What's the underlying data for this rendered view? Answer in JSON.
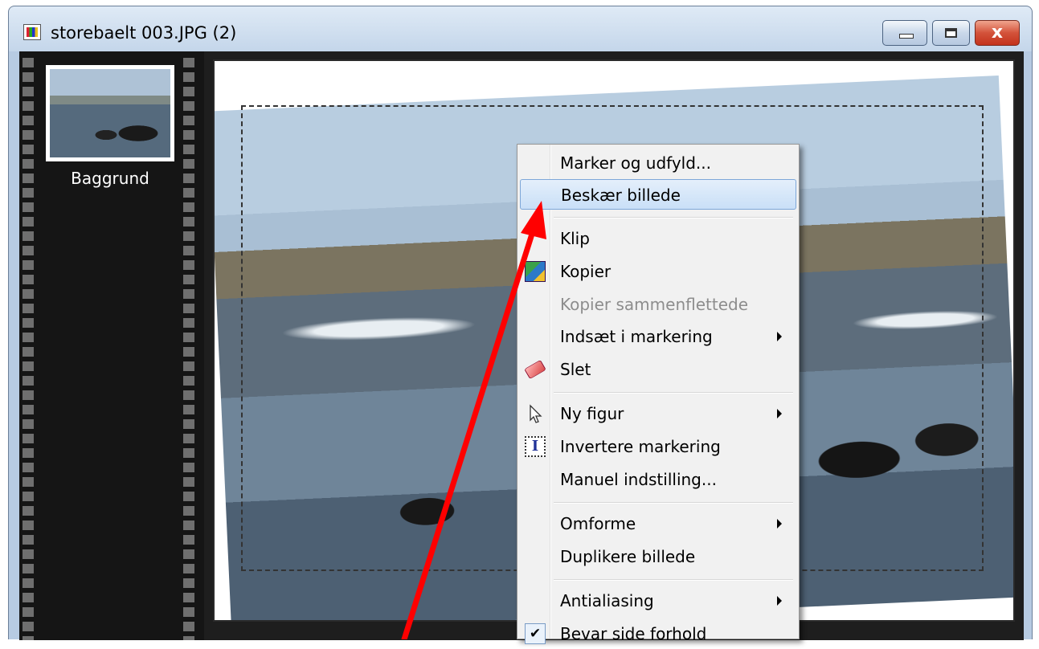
{
  "window": {
    "title": "storebaelt 003.JPG (2)",
    "close_glyph": "x",
    "icons": {
      "app": "image-document-icon",
      "minimize": "minimize-icon",
      "maximize": "maximize-icon",
      "close": "close-icon"
    }
  },
  "layers": [
    {
      "label": "Baggrund"
    }
  ],
  "context_menu": {
    "items": {
      "marker_og_udfyld": "Marker og udfyld...",
      "beskaer_billede": "Beskær billede",
      "klip": "Klip",
      "kopier": "Kopier",
      "kopier_sammenflettede": "Kopier sammenflettede",
      "indsaet_i_markering": "Indsæt i markering",
      "slet": "Slet",
      "ny_figur": "Ny figur",
      "invertere_markering": "Invertere markering",
      "manuel_indstilling": "Manuel indstilling...",
      "omforme": "Omforme",
      "duplikere_billede": "Duplikere billede",
      "antialiasing": "Antialiasing",
      "bevar_side_forhold": "Bevar side forhold"
    },
    "highlighted": "Beskær billede",
    "disabled": [
      "Kopier sammenflettede"
    ],
    "checked": [
      "Bevar side forhold"
    ],
    "invert_icon_letter": "I",
    "check_glyph": "✔"
  },
  "colors": {
    "highlight": "#c9dff7",
    "annotation_arrow": "#ff0000",
    "close_button": "#c4331c"
  }
}
